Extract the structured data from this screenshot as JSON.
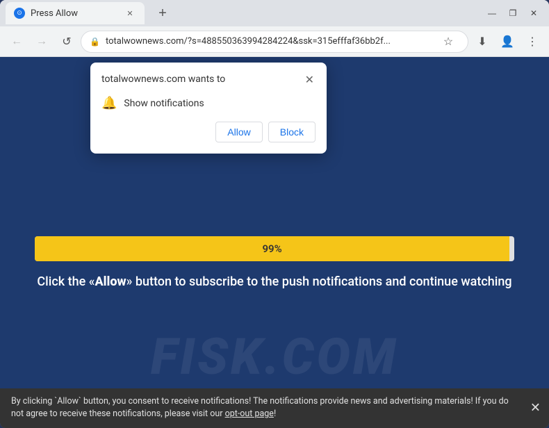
{
  "browser": {
    "title_bar": {
      "tab_title": "Press Allow",
      "tab_favicon": "⊙",
      "close_btn": "✕",
      "minimize_btn": "—",
      "maximize_btn": "❐",
      "new_tab_btn": "+"
    },
    "toolbar": {
      "back_btn": "←",
      "forward_btn": "→",
      "refresh_btn": "↺",
      "address": "totalwownews.com/?s=488550363994284224&ssk=315efffaf36bb2f...",
      "star_label": "☆",
      "profile_label": "👤",
      "menu_label": "⋮",
      "download_label": "⬇"
    }
  },
  "notification_popup": {
    "title": "totalwownews.com wants to",
    "close_label": "✕",
    "bell_icon": "🔔",
    "notification_label": "Show notifications",
    "allow_label": "Allow",
    "block_label": "Block"
  },
  "page": {
    "progress_percent": "99%",
    "progress_width": "99",
    "instruction_line1": "Click the «",
    "instruction_allow": "Allow",
    "instruction_line2": "» button to subscribe to the push notifications and continue watching",
    "watermark": "FISK.COM"
  },
  "bottom_bar": {
    "text": "By clicking `Allow` button, you consent to receive notifications! The notifications provide news and advertising materials! If you do not agree to receive these notifications, please visit our ",
    "link_text": "opt-out page",
    "text_end": "!",
    "close_label": "✕"
  }
}
